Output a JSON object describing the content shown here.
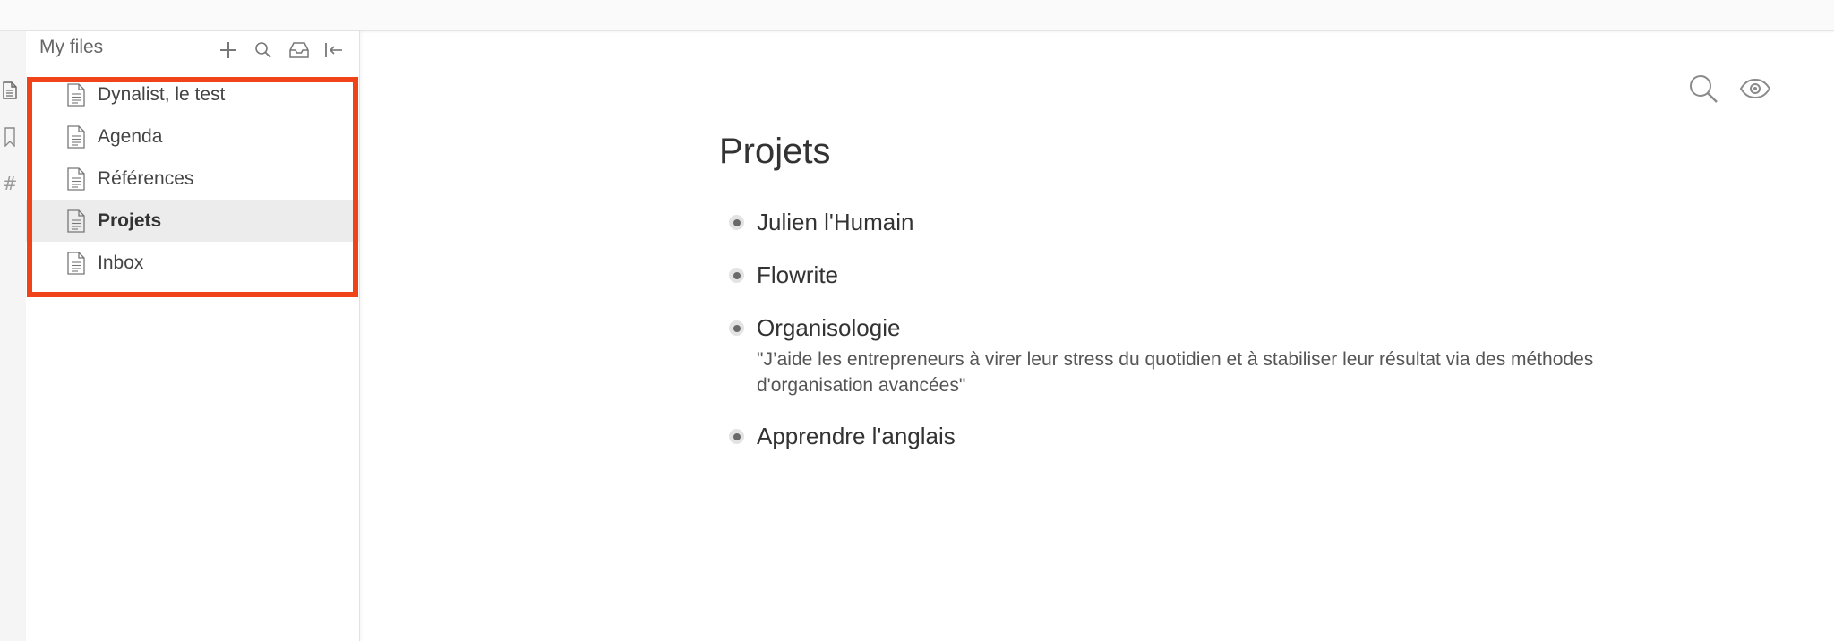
{
  "sidebar": {
    "title": "My files",
    "files": [
      {
        "label": "Dynalist, le test",
        "selected": false
      },
      {
        "label": "Agenda",
        "selected": false
      },
      {
        "label": "Références",
        "selected": false
      },
      {
        "label": "Projets",
        "selected": true
      },
      {
        "label": "Inbox",
        "selected": false
      }
    ]
  },
  "icons": {
    "rail": [
      "file-icon",
      "bookmark-icon",
      "hashtag-icon"
    ],
    "header": [
      "plus-icon",
      "search-icon",
      "inbox-icon",
      "collapse-sidebar-icon"
    ],
    "main": [
      "search-icon",
      "eye-icon"
    ]
  },
  "rail": {
    "tag_symbol": "#"
  },
  "document": {
    "title": "Projets",
    "items": [
      {
        "text": "Julien l'Humain"
      },
      {
        "text": "Flowrite"
      },
      {
        "text": "Organisologie",
        "note": "\"J’aide les entrepreneurs à virer leur stress du quotidien et à stabiliser leur résultat via des méthodes d'organisation avancées\""
      },
      {
        "text": "Apprendre l'anglais"
      }
    ]
  },
  "colors": {
    "highlight": "#f0431a",
    "selected_row": "#ececec"
  }
}
